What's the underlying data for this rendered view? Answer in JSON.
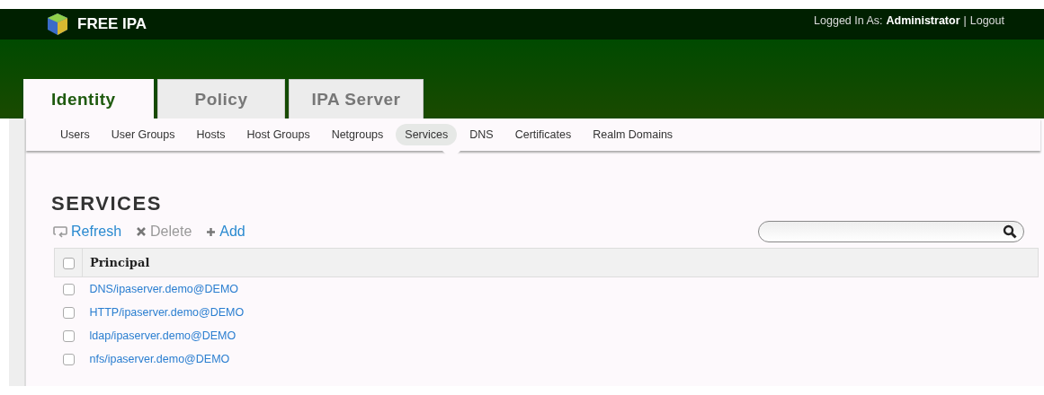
{
  "header": {
    "brand": "FREE IPA",
    "logged_in_label": "Logged In As:",
    "user": "Administrator",
    "separator": "|",
    "logout": "Logout"
  },
  "tabs": [
    {
      "label": "Identity",
      "selected": true
    },
    {
      "label": "Policy",
      "selected": false
    },
    {
      "label": "IPA Server",
      "selected": false
    }
  ],
  "subnav": [
    {
      "label": "Users",
      "selected": false
    },
    {
      "label": "User Groups",
      "selected": false
    },
    {
      "label": "Hosts",
      "selected": false
    },
    {
      "label": "Host Groups",
      "selected": false
    },
    {
      "label": "Netgroups",
      "selected": false
    },
    {
      "label": "Services",
      "selected": true
    },
    {
      "label": "DNS",
      "selected": false
    },
    {
      "label": "Certificates",
      "selected": false
    },
    {
      "label": "Realm Domains",
      "selected": false
    }
  ],
  "page_title": "SERVICES",
  "actions": [
    {
      "kind": "refresh",
      "label": "Refresh",
      "disabled": false
    },
    {
      "kind": "delete",
      "label": "Delete",
      "disabled": true
    },
    {
      "kind": "add",
      "label": "Add",
      "disabled": false
    }
  ],
  "table": {
    "columns": [
      "Principal"
    ],
    "select_all_checked": false,
    "rows": [
      {
        "principal": "DNS/ipaserver.demo@DEMO",
        "checked": false
      },
      {
        "principal": "HTTP/ipaserver.demo@DEMO",
        "checked": false
      },
      {
        "principal": "ldap/ipaserver.demo@DEMO",
        "checked": false
      },
      {
        "principal": "nfs/ipaserver.demo@DEMO",
        "checked": false
      }
    ]
  }
}
